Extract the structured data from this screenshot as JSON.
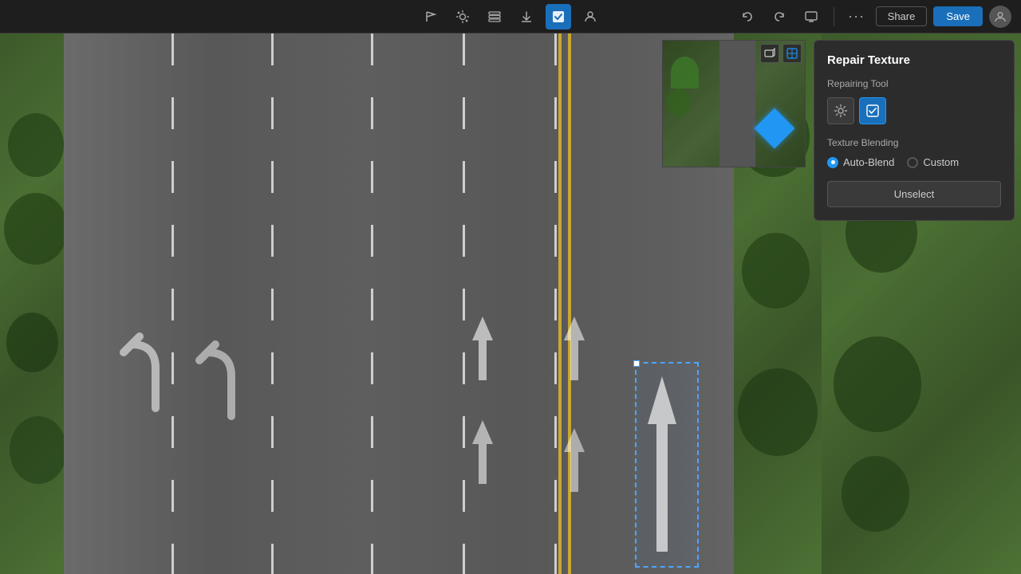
{
  "toolbar": {
    "tools": [
      {
        "name": "selection-tool",
        "icon": "⬚",
        "active": false
      },
      {
        "name": "sun-tool",
        "icon": "☀",
        "active": false
      },
      {
        "name": "layers-tool",
        "icon": "⊞",
        "active": false
      },
      {
        "name": "import-tool",
        "icon": "⬇",
        "active": false
      },
      {
        "name": "texture-tool",
        "icon": "▣",
        "active": true
      },
      {
        "name": "user-tool",
        "icon": "👤",
        "active": false
      }
    ],
    "undo_icon": "↩",
    "redo_icon": "↪",
    "monitor_icon": "⬛",
    "more_icon": "•••",
    "share_label": "Share",
    "save_label": "Save"
  },
  "minimap": {
    "view3d_icon": "3D",
    "viewtop_icon": "⊞"
  },
  "panel": {
    "title": "Repair Texture",
    "repairing_tool_label": "Repairing Tool",
    "texture_blending_label": "Texture Blending",
    "auto_blend_label": "Auto-Blend",
    "custom_label": "Custom",
    "auto_blend_selected": true,
    "unselect_label": "Unselect",
    "tool1_icon": "⚙",
    "tool2_icon": "▣"
  }
}
